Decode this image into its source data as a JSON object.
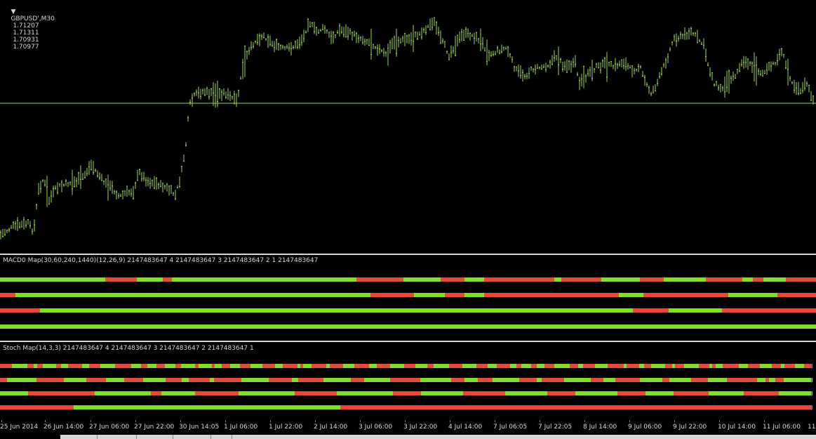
{
  "symbol_header": {
    "arrow": "▼",
    "symbol": "GBPUSD',M30",
    "open": "1.71207",
    "high": "1.71311",
    "low": "1.70931",
    "close": "1.70977"
  },
  "macd_pane": {
    "label": "MACD0 Map(30,60,240,1440)(12,26,9) 2147483647 4 2147483647 3 2147483647 2 1 2147483647"
  },
  "stoch_pane": {
    "label": "Stoch Map(14,3,3) 2147483647 4 2147483647 3 2147483647 2 2147483647 1"
  },
  "time_axis": {
    "labels": [
      "25 Jun 2014",
      "26 Jun 14:00",
      "27 Jun 06:00",
      "27 Jun 22:00",
      "30 Jun 14:05",
      "1 Jul 06:00",
      "1 Jul 22:00",
      "2 Jul 14:00",
      "3 Jul 06:00",
      "3 Jul 22:00",
      "4 Jul 14:00",
      "7 Jul 06:05",
      "7 Jul 22:05",
      "8 Jul 14:00",
      "9 Jul 06:00",
      "9 Jul 22:00",
      "10 Jul 14:00",
      "11 Jul 06:00",
      "11"
    ]
  },
  "colors": {
    "background": "#000000",
    "bar_color": "#9ed84a",
    "bullish": "#7fe02a",
    "bearish": "#e84a3a",
    "text": "#d8d8d8",
    "price_line": "#9ed84a"
  }
}
